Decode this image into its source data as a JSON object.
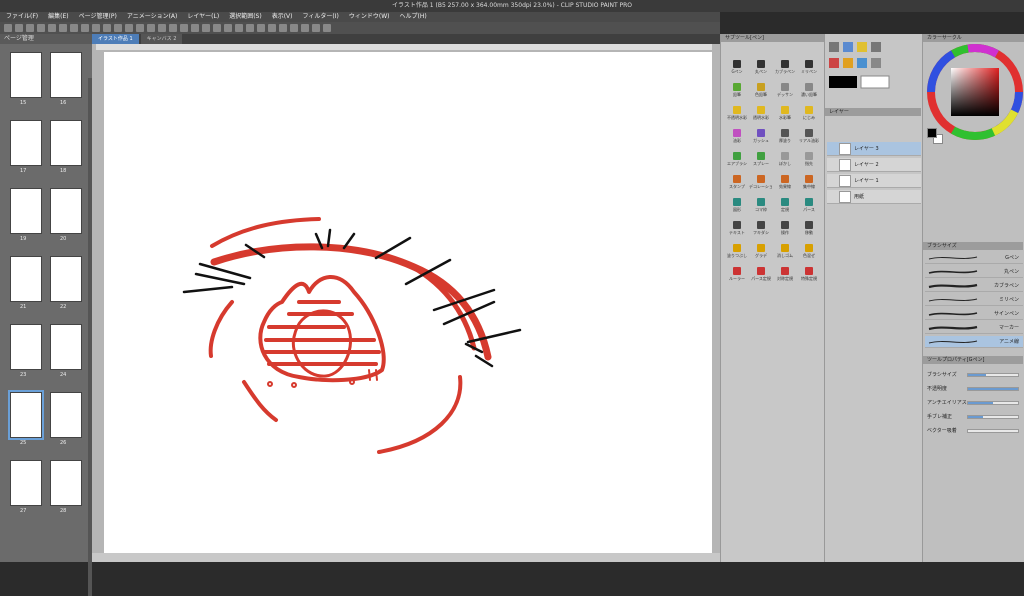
{
  "window": {
    "title": "イラスト作品 1 (B5 257.00 x 364.00mm 350dpi 23.0%) - CLIP STUDIO PAINT PRO"
  },
  "menu": [
    "ファイル(F)",
    "編集(E)",
    "ページ管理(P)",
    "アニメーション(A)",
    "レイヤー(L)",
    "選択範囲(S)",
    "表示(V)",
    "フィルター(I)",
    "ウィンドウ(W)",
    "ヘルプ(H)"
  ],
  "page_panel": {
    "title": "ページ管理",
    "pages": [
      {
        "label": "15",
        "selected": false
      },
      {
        "label": "16",
        "selected": false
      },
      {
        "label": "17",
        "selected": false
      },
      {
        "label": "18",
        "selected": false
      },
      {
        "label": "19",
        "selected": false
      },
      {
        "label": "20",
        "selected": false
      },
      {
        "label": "21",
        "selected": false
      },
      {
        "label": "22",
        "selected": false
      },
      {
        "label": "23",
        "selected": false
      },
      {
        "label": "24",
        "selected": false
      },
      {
        "label": "25",
        "selected": true
      },
      {
        "label": "26",
        "selected": false
      },
      {
        "label": "27",
        "selected": false
      },
      {
        "label": "28",
        "selected": false
      }
    ]
  },
  "tabs": [
    {
      "label": "イラスト作品 1",
      "active": true
    },
    {
      "label": "キャンバス 2",
      "active": false
    }
  ],
  "tool_panel": {
    "title": "サブツール[ペン]",
    "subtools": [
      {
        "label": "Gペン",
        "color": "#333333"
      },
      {
        "label": "丸ペン",
        "color": "#333333"
      },
      {
        "label": "カブラペン",
        "color": "#333333"
      },
      {
        "label": "ミリペン",
        "color": "#333333"
      },
      {
        "label": "鉛筆",
        "color": "#58a832"
      },
      {
        "label": "色鉛筆",
        "color": "#c8a020"
      },
      {
        "label": "デッサン",
        "color": "#888888"
      },
      {
        "label": "濃い鉛筆",
        "color": "#888888"
      },
      {
        "label": "不透明水彩",
        "color": "#e0b820"
      },
      {
        "label": "透明水彩",
        "color": "#e0b820"
      },
      {
        "label": "水彩筆",
        "color": "#e0b820"
      },
      {
        "label": "にじみ",
        "color": "#e0b820"
      },
      {
        "label": "油彩",
        "color": "#c050c0"
      },
      {
        "label": "ガッシュ",
        "color": "#7050c0"
      },
      {
        "label": "厚塗り",
        "color": "#555555"
      },
      {
        "label": "リアル油彩",
        "color": "#555555"
      },
      {
        "label": "エアブラシ",
        "color": "#40a040"
      },
      {
        "label": "スプレー",
        "color": "#40a040"
      },
      {
        "label": "ぼかし",
        "color": "#999999"
      },
      {
        "label": "指先",
        "color": "#999999"
      },
      {
        "label": "スタンプ",
        "color": "#cc6622"
      },
      {
        "label": "デコレーション",
        "color": "#cc6622"
      },
      {
        "label": "効果線",
        "color": "#cc6622"
      },
      {
        "label": "集中線",
        "color": "#cc6622"
      },
      {
        "label": "図形",
        "color": "#2a8a80"
      },
      {
        "label": "コマ枠",
        "color": "#2a8a80"
      },
      {
        "label": "定規",
        "color": "#2a8a80"
      },
      {
        "label": "パース",
        "color": "#2a8a80"
      },
      {
        "label": "テキスト",
        "color": "#444444"
      },
      {
        "label": "フキダシ",
        "color": "#444444"
      },
      {
        "label": "操作",
        "color": "#444444"
      },
      {
        "label": "移動",
        "color": "#444444"
      },
      {
        "label": "塗りつぶし",
        "color": "#d8a000"
      },
      {
        "label": "グラデ",
        "color": "#d8a000"
      },
      {
        "label": "消しゴム",
        "color": "#d8a000"
      },
      {
        "label": "色混ぜ",
        "color": "#d8a000"
      },
      {
        "label": "ルーラー",
        "color": "#cc3333"
      },
      {
        "label": "パース定規",
        "color": "#cc3333"
      },
      {
        "label": "対称定規",
        "color": "#cc3333"
      },
      {
        "label": "特殊定規",
        "color": "#cc3333"
      }
    ]
  },
  "layer_panel": {
    "title": "レイヤー",
    "layers": [
      {
        "name": "レイヤー 3",
        "selected": true
      },
      {
        "name": "レイヤー 2",
        "selected": false
      },
      {
        "name": "レイヤー 1",
        "selected": false
      },
      {
        "name": "用紙",
        "selected": false
      }
    ]
  },
  "color_panel": {
    "title": "カラーサークル",
    "main_color": "#000000",
    "sub_color": "#ffffff"
  },
  "brush_panel": {
    "title": "ブラシサイズ",
    "brushes": [
      {
        "name": "Gペン",
        "selected": false
      },
      {
        "name": "丸ペン",
        "selected": false
      },
      {
        "name": "カブラペン",
        "selected": false
      },
      {
        "name": "ミリペン",
        "selected": false
      },
      {
        "name": "サインペン",
        "selected": false
      },
      {
        "name": "マーカー",
        "selected": false
      },
      {
        "name": "アニメ線",
        "selected": true
      }
    ]
  },
  "tool_property": {
    "title": "ツールプロパティ[Gペン]",
    "rows": [
      {
        "label": "ブラシサイズ",
        "value": 0.35
      },
      {
        "label": "不透明度",
        "value": 1.0
      },
      {
        "label": "アンチエイリアス",
        "value": 0.5
      },
      {
        "label": "手ブレ補正",
        "value": 0.3
      },
      {
        "label": "ベクター吸着",
        "value": 0.0
      }
    ]
  },
  "drawing": {
    "stroke_red": "#d63a2e",
    "stroke_black": "#111111"
  }
}
